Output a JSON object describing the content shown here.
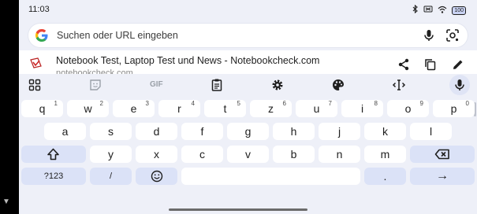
{
  "status": {
    "time": "11:03",
    "icons": [
      "bluetooth-icon",
      "mute-icon",
      "wifi-icon",
      "battery-icon"
    ],
    "battery": "100"
  },
  "search": {
    "placeholder": "Suchen oder URL eingeben"
  },
  "suggestion": {
    "title": "Notebook Test, Laptop Test und News - Notebookcheck.com",
    "url": "notebookcheck.com"
  },
  "toolbar": {
    "gif": "GIF"
  },
  "keyboard": {
    "row1": [
      {
        "k": "q",
        "h": "1"
      },
      {
        "k": "w",
        "h": "2"
      },
      {
        "k": "e",
        "h": "3"
      },
      {
        "k": "r",
        "h": "4"
      },
      {
        "k": "t",
        "h": "5"
      },
      {
        "k": "z",
        "h": "6"
      },
      {
        "k": "u",
        "h": "7"
      },
      {
        "k": "i",
        "h": "8"
      },
      {
        "k": "o",
        "h": "9"
      },
      {
        "k": "p",
        "h": "0"
      }
    ],
    "row2": [
      "a",
      "s",
      "d",
      "f",
      "g",
      "h",
      "j",
      "k",
      "l"
    ],
    "row3": [
      "y",
      "x",
      "c",
      "v",
      "b",
      "n",
      "m"
    ],
    "symbols": "?123",
    "slash": "/",
    "period": ".",
    "enter": "→"
  },
  "colors": {
    "key_bg": "#ffffff",
    "modifier_bg": "#dbe2f7",
    "panel_bg": "#eef0f8"
  }
}
